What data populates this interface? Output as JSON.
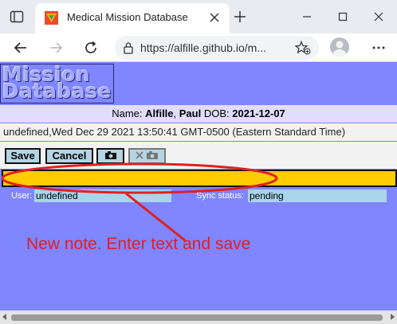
{
  "browser": {
    "tab_title": "Medical Mission Database",
    "url": "https://alfille.github.io/m..."
  },
  "page": {
    "logo_text": "Mission Database",
    "logo_line1": "Mission",
    "logo_line2": "Database",
    "patient": {
      "name_label": "Name:",
      "last_name": "Alfille",
      "first_name": "Paul",
      "dob_label": "DOB:",
      "dob": "2021-12-07"
    },
    "note_timestamp": "undefined,Wed Dec 29 2021 13:50:41 GMT-0500 (Eastern Standard Time)",
    "buttons": {
      "save": "Save",
      "cancel": "Cancel"
    },
    "note_text": "",
    "user_label": "User:",
    "user_value": "undefined",
    "sync_label": "Sync status:",
    "sync_value": "pending"
  },
  "annotation": {
    "text": "New note. Enter text and save",
    "color": "#e02020"
  },
  "colors": {
    "page_background": "#7f86ff",
    "note_field": "#ffcc00",
    "button": "#b5d4e4"
  }
}
